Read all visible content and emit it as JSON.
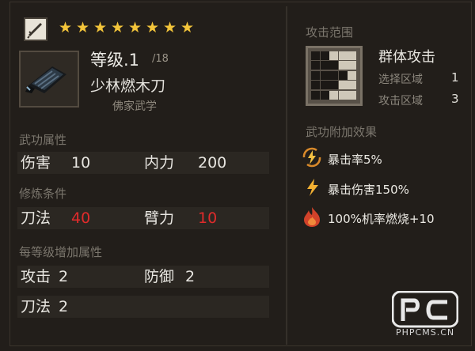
{
  "header": {
    "stars": 8,
    "star_glyph": "★",
    "star_color": "#f2c43a"
  },
  "item": {
    "level_label": "等级.1",
    "level_max": "/18",
    "name": "少林燃木刀",
    "school": "佛家武学",
    "icon": "dark-blade-item-icon",
    "type_icon": "sword-type-icon"
  },
  "stats": {
    "section_title": "武功属性",
    "damage_label": "伤害",
    "damage_value": "10",
    "inner_label": "内力",
    "inner_value": "200"
  },
  "requirements": {
    "section_title": "修炼条件",
    "blade_label": "刀法",
    "blade_value": "40",
    "arm_label": "臂力",
    "arm_value": "10"
  },
  "per_level": {
    "section_title": "每等级增加属性",
    "attack_label": "攻击",
    "attack_value": "2",
    "defense_label": "防御",
    "defense_value": "2",
    "blade_label": "刀法",
    "blade_value": "2"
  },
  "range": {
    "section_title": "攻击范围",
    "type": "群体攻击",
    "select_label": "选择区域",
    "select_value": "1",
    "attack_label": "攻击区域",
    "attack_value": "3"
  },
  "effects": {
    "section_title": "武功附加效果",
    "items": [
      {
        "text": "暴击率5%",
        "icon": "lightning-circle-icon"
      },
      {
        "text": "暴击伤害150%",
        "icon": "lightning-icon"
      },
      {
        "text": "100%机率燃烧+10",
        "icon": "fire-icon"
      }
    ]
  },
  "watermark": {
    "text": "PHPCMS.CN",
    "logo": "PC"
  },
  "colors": {
    "requirement_red": "#e02b2b",
    "star_gold": "#f2c43a"
  }
}
